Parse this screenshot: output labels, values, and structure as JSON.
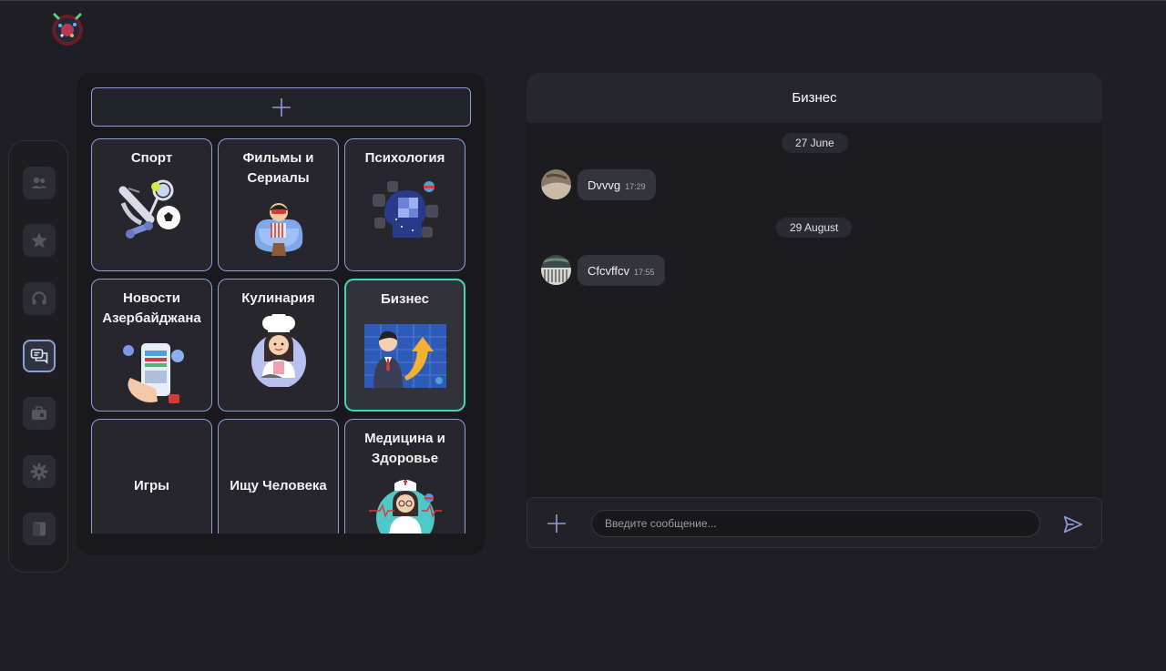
{
  "app": {
    "logo_icon": "app-logo-icon"
  },
  "rail": {
    "items": [
      {
        "icon": "users-icon",
        "active": false
      },
      {
        "icon": "star-icon",
        "active": false
      },
      {
        "icon": "headset-icon",
        "active": false
      },
      {
        "icon": "chat-icon",
        "active": true
      },
      {
        "icon": "briefcase-icon",
        "active": false
      },
      {
        "icon": "gear-icon",
        "active": false
      },
      {
        "icon": "logout-icon",
        "active": false
      }
    ]
  },
  "categories": {
    "add_icon": "plus-icon",
    "items": [
      {
        "label": "Спорт"
      },
      {
        "label": "Фильмы и Сериалы"
      },
      {
        "label": "Психология"
      },
      {
        "label": "Новости Азербайджана"
      },
      {
        "label": "Кулинария"
      },
      {
        "label": "Бизнес",
        "active": true
      },
      {
        "label": "Игры"
      },
      {
        "label": "Ищу Человека"
      },
      {
        "label": "Медицина и Здоровье"
      }
    ]
  },
  "chat": {
    "title": "Бизнес",
    "days": [
      {
        "date": "27 June",
        "messages": [
          {
            "text": "Dvvvg",
            "time": "17:29"
          }
        ]
      },
      {
        "date": "29 August",
        "messages": [
          {
            "text": "Cfcvffcv",
            "time": "17:55"
          }
        ]
      }
    ],
    "input": {
      "placeholder": "Введите сообщение...",
      "value": ""
    }
  },
  "colors": {
    "accent": "#8a9fd8",
    "active_tile_border": "#3ed6b4",
    "background": "#1e1e24"
  }
}
